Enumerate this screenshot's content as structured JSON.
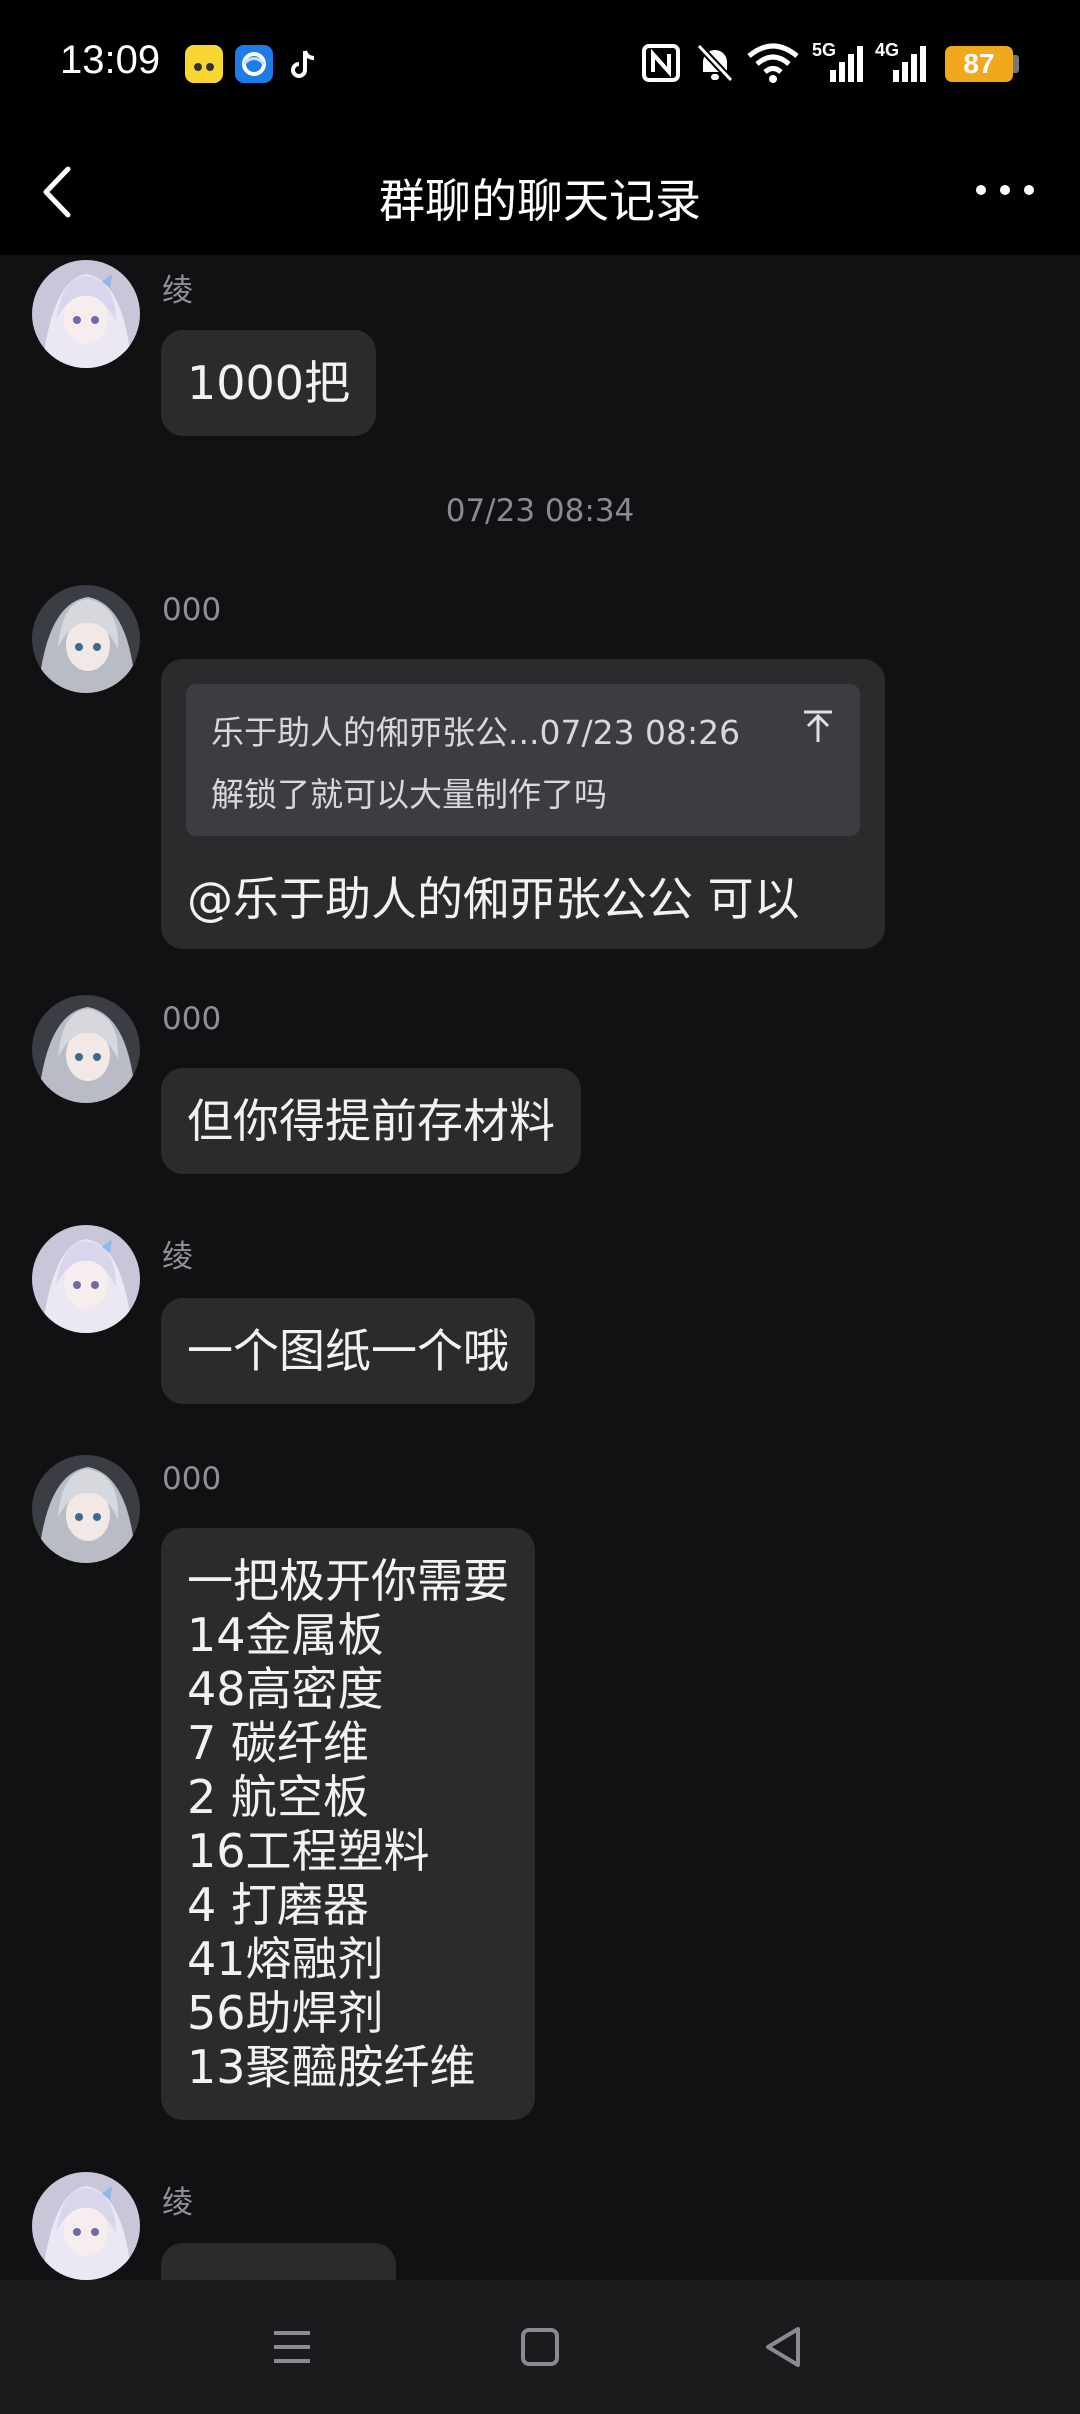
{
  "status_bar": {
    "time": "13:09",
    "battery": "87",
    "network_1": "5G",
    "network_2": "4G",
    "icons": [
      "nfc-icon",
      "mute-icon",
      "wifi-icon",
      "signal-icon",
      "signal-icon",
      "battery-icon"
    ],
    "app_icons": [
      "yellow-app-icon",
      "blue-app-icon",
      "tiktok-icon"
    ]
  },
  "header": {
    "title": "群聊的聊天记录"
  },
  "messages": [
    {
      "sender": "绫",
      "text": "1000把"
    },
    {
      "timestamp": "07/23 08:34"
    },
    {
      "sender": "000",
      "quote": {
        "meta": "乐于助人的俰丣张公...07/23 08:26",
        "text": "解锁了就可以大量制作了吗"
      },
      "text": "@乐于助人的俰丣张公公 可以"
    },
    {
      "sender": "000",
      "text": "但你得提前存材料"
    },
    {
      "sender": "绫",
      "text": "一个图纸一个哦"
    },
    {
      "sender": "000",
      "text": "一把极开你需要\n14金属板\n48高密度\n7 碳纤维\n2 航空板\n16工程塑料\n4 打磨器\n41熔融剂\n56助焊剂\n13聚醯胺纤维"
    },
    {
      "sender": "绫",
      "text": ""
    }
  ],
  "colors": {
    "background": "#111113",
    "bubble": "#2b2b2e",
    "quote_bg": "#3d3d41",
    "battery": "#f2a81d",
    "secondary_text": "#8f8f95"
  }
}
